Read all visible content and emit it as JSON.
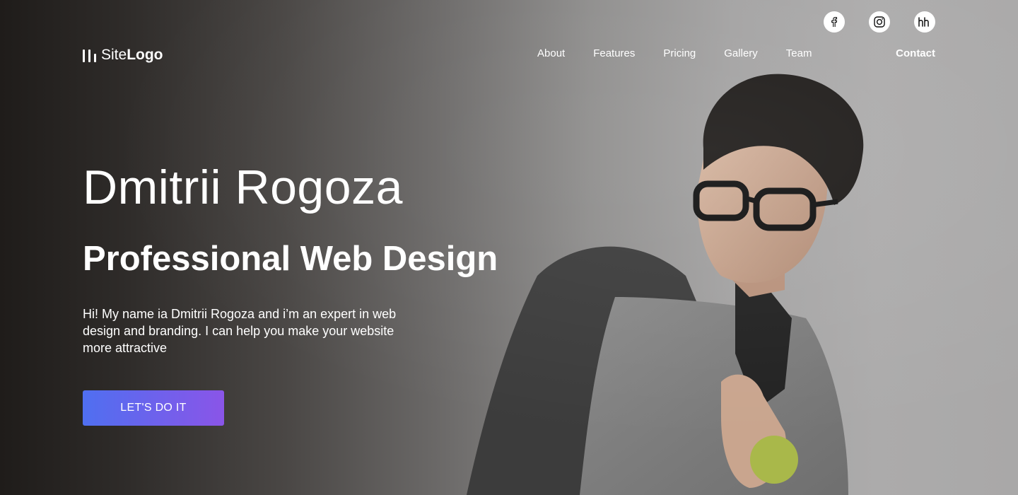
{
  "header": {
    "logo": {
      "light": "Site",
      "bold": "Logo"
    },
    "nav": [
      "About",
      "Features",
      "Pricing",
      "Gallery",
      "Team"
    ],
    "contact": "Contact",
    "social": [
      {
        "icon": "facebook-icon",
        "label": "f"
      },
      {
        "icon": "instagram-icon"
      },
      {
        "icon": "hh-icon",
        "label": "hh"
      }
    ]
  },
  "hero": {
    "name": "Dmitrii Rogoza",
    "title": "Professional Web Design",
    "intro": "Hi! My name ia Dmitrii Rogoza and i’m an expert in web design and branding. I can help you make your website more attractive",
    "cta": "LET'S DO IT"
  },
  "colors": {
    "accent_start": "#4f6ff0",
    "accent_end": "#8a55e8",
    "text": "#ffffff"
  }
}
